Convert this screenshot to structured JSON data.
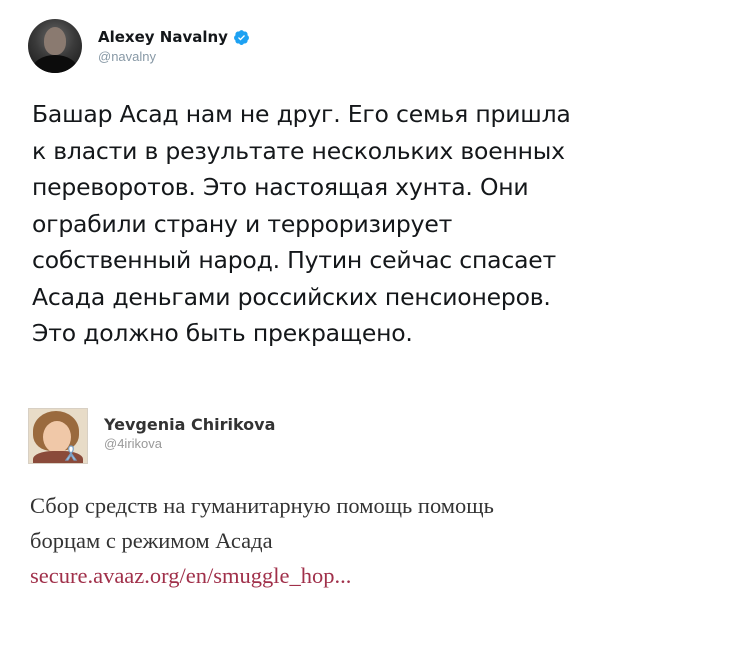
{
  "tweet_main": {
    "author_name": "Alexey Navalny",
    "handle": "@navalny",
    "verified_icon": "verified-badge-icon",
    "text_lines": [
      "Башар Асад нам не друг. Его семья пришла",
      "к власти в результате нескольких военных",
      "переворотов. Это настоящая хунта. Они",
      "ограбили страну и терроризирует",
      "собственный народ. Путин сейчас спасает",
      "Асада деньгами российских пенсионеров.",
      "Это должно быть прекращено."
    ],
    "colors": {
      "verified": "#1da1f2",
      "text": "#14171a",
      "handle": "#8899a6"
    }
  },
  "tweet_quoted": {
    "author_name": "Yevgenia Chirikova",
    "handle": "@4irikova",
    "text_lines": [
      "Сбор средств на гуманитарную помощь помощь",
      "борцам с режимом Асада"
    ],
    "link_text": "secure.avaaz.org/en/smuggle_hop...",
    "colors": {
      "text": "#333333",
      "link": "#a0304a"
    }
  }
}
